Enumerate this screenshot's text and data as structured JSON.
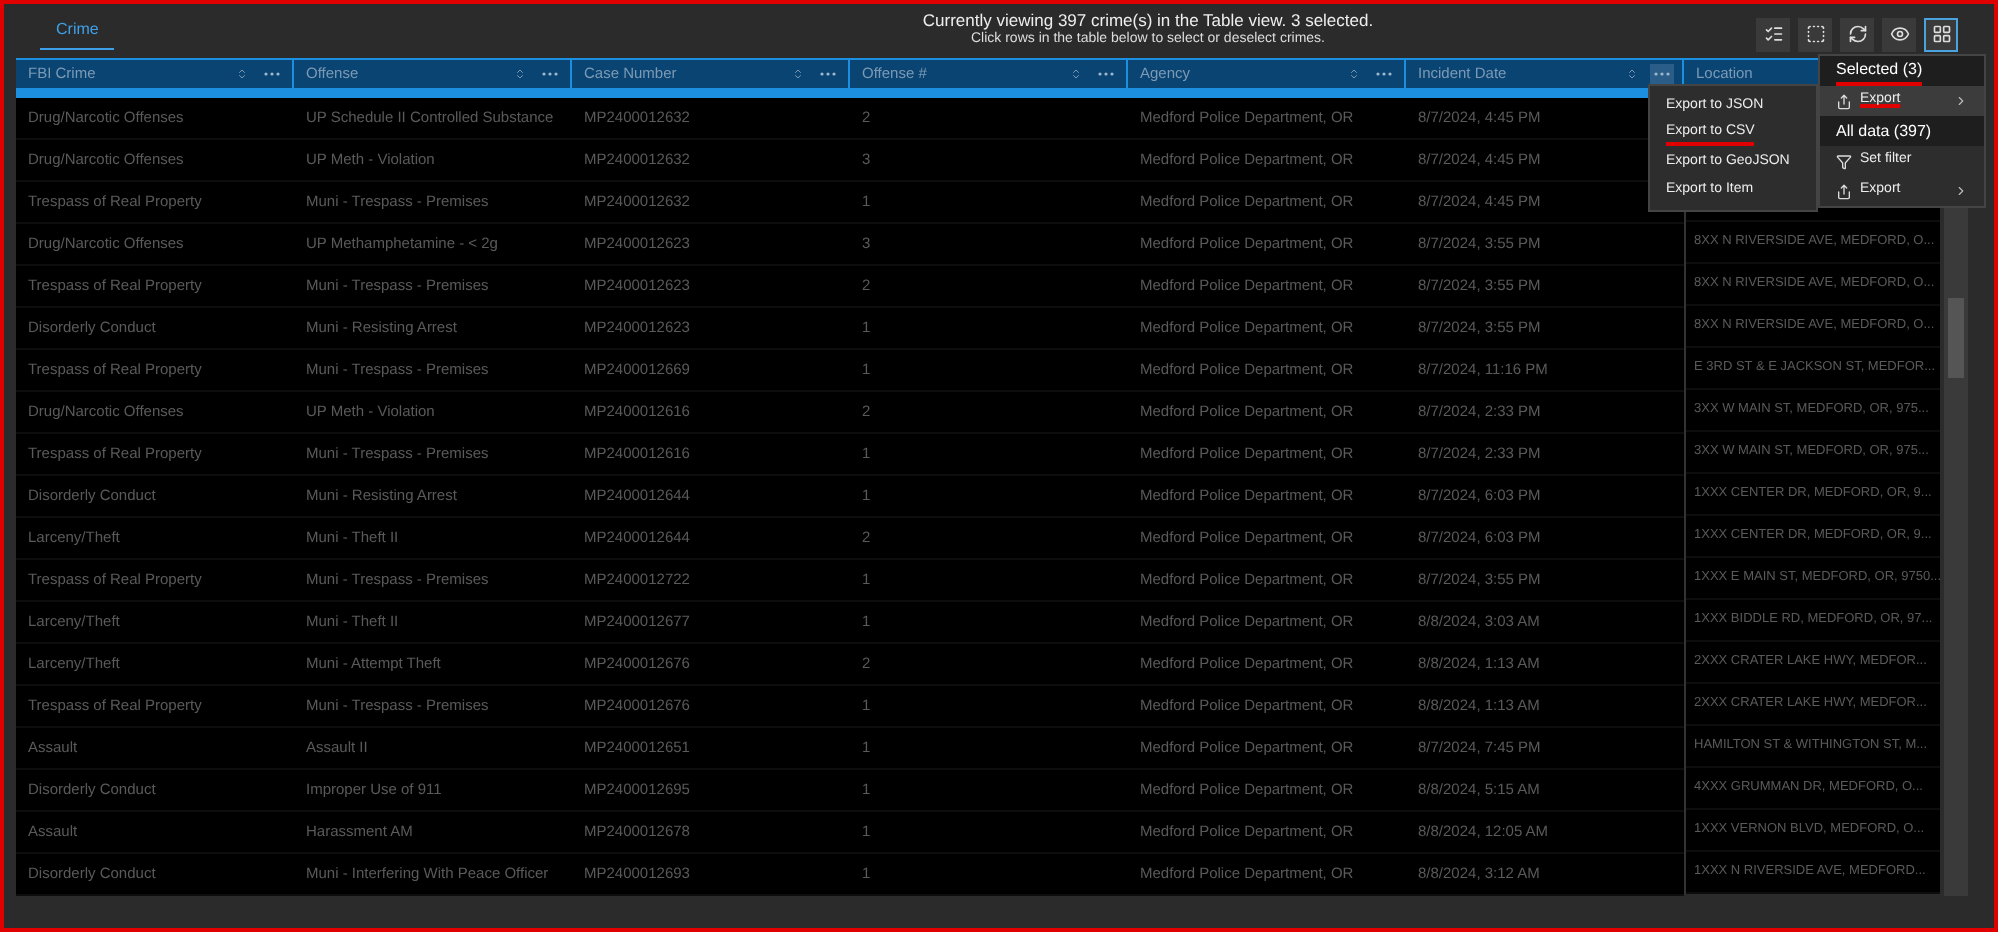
{
  "tabs": [
    {
      "label": "Crime",
      "selected": true
    }
  ],
  "info": {
    "line1": "Currently viewing 397 crime(s) in the Table view. 3 selected.",
    "line2": "Click rows in the table below to select or deselect crimes."
  },
  "toolbar": [
    {
      "kind": "list",
      "selected": false
    },
    {
      "kind": "deselect",
      "selected": false
    },
    {
      "kind": "refresh",
      "selected": false
    },
    {
      "kind": "eye",
      "selected": false
    },
    {
      "kind": "grid",
      "selected": true
    }
  ],
  "table": {
    "columns": [
      {
        "label": "FBI Crime",
        "menu_open": false
      },
      {
        "label": "Offense",
        "menu_open": false
      },
      {
        "label": "Case Number",
        "menu_open": false
      },
      {
        "label": "Offense #",
        "menu_open": false
      },
      {
        "label": "Agency",
        "menu_open": false
      },
      {
        "label": "Incident Date",
        "menu_open": true
      },
      {
        "label": "Location"
      }
    ],
    "rows": [
      [
        "Drug/Narcotic Offenses",
        "UP Schedule II Controlled Substance",
        "MP2400012632",
        "2",
        "Medford Police Department, OR",
        "8/7/2024, 4:45 PM"
      ],
      [
        "Drug/Narcotic Offenses",
        "UP Meth - Violation",
        "MP2400012632",
        "3",
        "Medford Police Department, OR",
        "8/7/2024, 4:45 PM"
      ],
      [
        "Trespass of Real Property",
        "Muni - Trespass - Premises",
        "MP2400012632",
        "1",
        "Medford Police Department, OR",
        "8/7/2024, 4:45 PM"
      ],
      [
        "Drug/Narcotic Offenses",
        "UP Methamphetamine - < 2g",
        "MP2400012623",
        "3",
        "Medford Police Department, OR",
        "8/7/2024, 3:55 PM",
        "8XX N RIVERSIDE AVE, MEDFORD, O..."
      ],
      [
        "Trespass of Real Property",
        "Muni - Trespass - Premises",
        "MP2400012623",
        "2",
        "Medford Police Department, OR",
        "8/7/2024, 3:55 PM",
        "8XX N RIVERSIDE AVE, MEDFORD, O..."
      ],
      [
        "Disorderly Conduct",
        "Muni - Resisting Arrest",
        "MP2400012623",
        "1",
        "Medford Police Department, OR",
        "8/7/2024, 3:55 PM",
        "8XX N RIVERSIDE AVE, MEDFORD, O..."
      ],
      [
        "Trespass of Real Property",
        "Muni - Trespass - Premises",
        "MP2400012669",
        "1",
        "Medford Police Department, OR",
        "8/7/2024, 11:16 PM",
        "E 3RD ST & E JACKSON ST, MEDFOR..."
      ],
      [
        "Drug/Narcotic Offenses",
        "UP Meth - Violation",
        "MP2400012616",
        "2",
        "Medford Police Department, OR",
        "8/7/2024, 2:33 PM",
        "3XX W MAIN ST, MEDFORD, OR, 975..."
      ],
      [
        "Trespass of Real Property",
        "Muni - Trespass - Premises",
        "MP2400012616",
        "1",
        "Medford Police Department, OR",
        "8/7/2024, 2:33 PM",
        "3XX W MAIN ST, MEDFORD, OR, 975..."
      ],
      [
        "Disorderly Conduct",
        "Muni - Resisting Arrest",
        "MP2400012644",
        "1",
        "Medford Police Department, OR",
        "8/7/2024, 6:03 PM",
        "1XXX CENTER DR, MEDFORD, OR, 9..."
      ],
      [
        "Larceny/Theft",
        "Muni - Theft II",
        "MP2400012644",
        "2",
        "Medford Police Department, OR",
        "8/7/2024, 6:03 PM",
        "1XXX CENTER DR, MEDFORD, OR, 9..."
      ],
      [
        "Trespass of Real Property",
        "Muni - Trespass - Premises",
        "MP2400012722",
        "1",
        "Medford Police Department, OR",
        "8/7/2024, 3:55 PM",
        "1XXX E MAIN ST, MEDFORD, OR, 9750..."
      ],
      [
        "Larceny/Theft",
        "Muni - Theft II",
        "MP2400012677",
        "1",
        "Medford Police Department, OR",
        "8/8/2024, 3:03 AM",
        "1XXX BIDDLE RD, MEDFORD, OR, 97..."
      ],
      [
        "Larceny/Theft",
        "Muni - Attempt Theft",
        "MP2400012676",
        "2",
        "Medford Police Department, OR",
        "8/8/2024, 1:13 AM",
        "2XXX CRATER LAKE HWY, MEDFOR..."
      ],
      [
        "Trespass of Real Property",
        "Muni - Trespass - Premises",
        "MP2400012676",
        "1",
        "Medford Police Department, OR",
        "8/8/2024, 1:13 AM",
        "2XXX CRATER LAKE HWY, MEDFOR..."
      ],
      [
        "Assault",
        "Assault II",
        "MP2400012651",
        "1",
        "Medford Police Department, OR",
        "8/7/2024, 7:45 PM",
        "HAMILTON ST & WITHINGTON ST, M..."
      ],
      [
        "Disorderly Conduct",
        "Improper Use of 911",
        "MP2400012695",
        "1",
        "Medford Police Department, OR",
        "8/8/2024, 5:15 AM",
        "4XXX GRUMMAN DR, MEDFORD, O..."
      ],
      [
        "Assault",
        "Harassment AM",
        "MP2400012678",
        "1",
        "Medford Police Department, OR",
        "8/8/2024, 12:05 AM",
        "1XXX VERNON BLVD, MEDFORD, O..."
      ],
      [
        "Disorderly Conduct",
        "Muni - Interfering With Peace Officer",
        "MP2400012693",
        "1",
        "Medford Police Department, OR",
        "8/8/2024, 3:12 AM",
        "1XXX N RIVERSIDE AVE, MEDFORD..."
      ]
    ]
  },
  "export_submenu": [
    {
      "label": "Export to JSON",
      "underlined": false
    },
    {
      "label": "Export to CSV",
      "underlined": true
    },
    {
      "label": "Export to GeoJSON",
      "underlined": false
    },
    {
      "label": "Export to Item",
      "underlined": false
    }
  ],
  "actions_menu": [
    {
      "kind": "header",
      "label": "Selected (3)",
      "underlined": true
    },
    {
      "kind": "export",
      "label": "Export",
      "underlined": true,
      "selected": true
    },
    {
      "kind": "header",
      "label": "All data (397)",
      "underlined": false
    },
    {
      "kind": "filter",
      "label": "Set filter",
      "underlined": false,
      "selected": false
    },
    {
      "kind": "export",
      "label": "Export",
      "underlined": false,
      "selected": false
    }
  ]
}
